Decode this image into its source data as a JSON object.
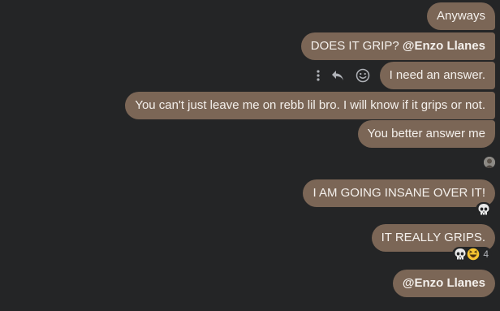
{
  "messages": [
    {
      "text": "Anyways"
    },
    {
      "text": "DOES IT GRIP? ",
      "mention": "@Enzo Llanes"
    },
    {
      "text": "I need an answer."
    },
    {
      "text": "You can't just leave me on rebb lil bro. I will know if it grips or not."
    },
    {
      "text": "You better answer me"
    },
    {
      "text": "I AM GOING INSANE OVER IT!"
    },
    {
      "text": "IT REALLY GRIPS."
    },
    {
      "mention": "@Enzo Llanes"
    }
  ],
  "reactions": {
    "insane_message": {
      "emoji": "skull"
    },
    "grips_message": {
      "emojis": [
        "skull",
        "laughing-face"
      ],
      "count": "4"
    }
  },
  "colors": {
    "background": "#242526",
    "bubble": "#7b6656",
    "bubble_text": "#f4f0ec",
    "icon": "#b0b3b8"
  },
  "icons": {
    "more": "more-vertical-icon",
    "reply": "reply-icon",
    "react": "smiley-icon"
  }
}
